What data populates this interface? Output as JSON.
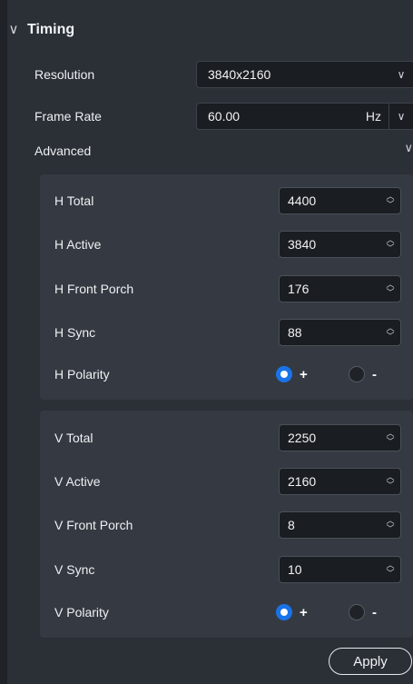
{
  "section": {
    "title": "Timing"
  },
  "resolution": {
    "label": "Resolution",
    "value": "3840x2160"
  },
  "frame_rate": {
    "label": "Frame Rate",
    "value": "60.00",
    "unit": "Hz"
  },
  "advanced": {
    "label": "Advanced"
  },
  "horizontal": [
    {
      "label": "H Total",
      "value": "4400"
    },
    {
      "label": "H Active",
      "value": "3840"
    },
    {
      "label": "H Front Porch",
      "value": "176"
    },
    {
      "label": "H Sync",
      "value": "88"
    }
  ],
  "h_polarity": {
    "label": "H Polarity",
    "positive": "+",
    "negative": "-",
    "selected": "+"
  },
  "vertical": [
    {
      "label": "V Total",
      "value": "2250"
    },
    {
      "label": "V Active",
      "value": "2160"
    },
    {
      "label": "V Front Porch",
      "value": "8"
    },
    {
      "label": "V Sync",
      "value": "10"
    }
  ],
  "v_polarity": {
    "label": "V Polarity",
    "positive": "+",
    "negative": "-",
    "selected": "+"
  },
  "apply_label": "Apply",
  "colors": {
    "accent": "#1a73e8",
    "panel": "#2b2f36",
    "group": "#353a42"
  }
}
